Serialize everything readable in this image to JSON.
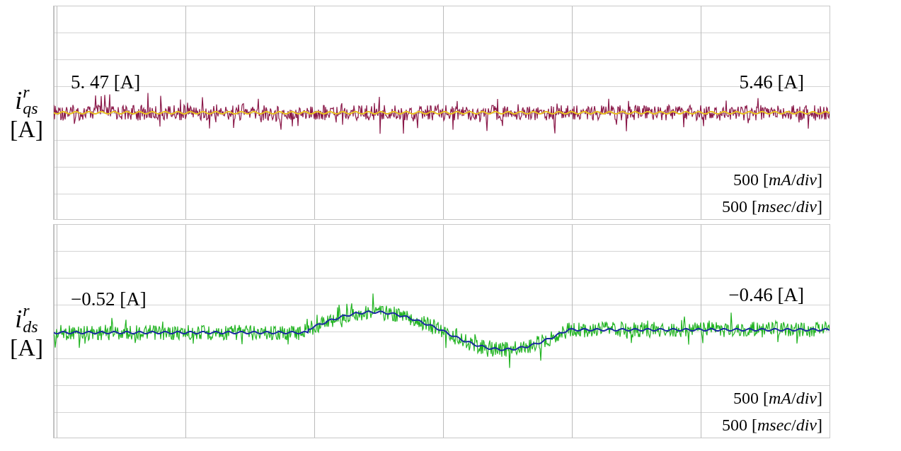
{
  "panels": [
    {
      "kind": "flat",
      "symbol": "i",
      "superscript": "r",
      "subscript": "qs",
      "unit": "[A]",
      "start_value": "5. 47 [A]",
      "end_value": "5.46 [A]",
      "vertical_scale": "500 [*mA*/*div*]",
      "time_scale": "500 [*msec*/*div*]",
      "color": "#8b1a4a"
    },
    {
      "kind": "dip",
      "symbol": "i",
      "superscript": "r",
      "subscript": "ds",
      "unit": "[A]",
      "start_value": "−0.52 [A]",
      "end_value": "−0.46 [A]",
      "vertical_scale": "500 [*mA*/*div*]",
      "time_scale": "500 [*msec*/*div*]",
      "color": "#22b422"
    }
  ]
}
